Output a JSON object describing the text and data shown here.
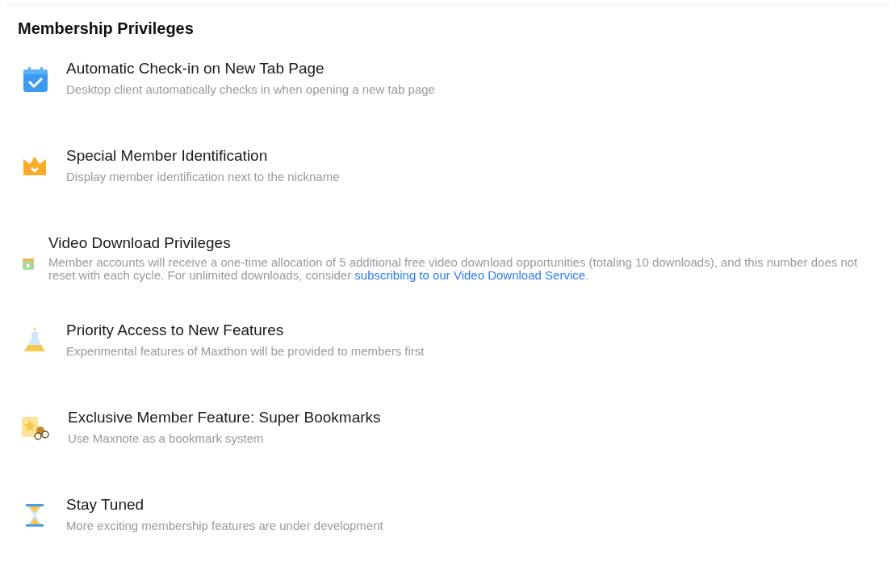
{
  "heading": "Membership Privileges",
  "privileges": [
    {
      "kind": "standard",
      "title": "Automatic Check-in on New Tab Page",
      "description": "Desktop client automatically checks in when opening a new tab page"
    },
    {
      "kind": "standard",
      "title": "Special Member Identification",
      "description": "Display member identification next to the nickname"
    },
    {
      "kind": "compact",
      "title": "Video Download Privileges",
      "description": "Member accounts will receive a one-time allocation of 5 additional free video download opportunities (totaling 10 downloads), and this number does not reset with each cycle. For unlimited downloads, consider",
      "link": "subscribing to our Video Download Service",
      "after_link": "."
    },
    {
      "kind": "standard",
      "title": "Priority Access to New Features",
      "description": "Experimental features of Maxthon will be provided to members first"
    },
    {
      "kind": "standard",
      "title": "Exclusive Member Feature: Super Bookmarks",
      "description": "Use Maxnote as a bookmark system"
    },
    {
      "kind": "standard",
      "title": "Stay Tuned",
      "description": "More exciting membership features are under development"
    }
  ]
}
